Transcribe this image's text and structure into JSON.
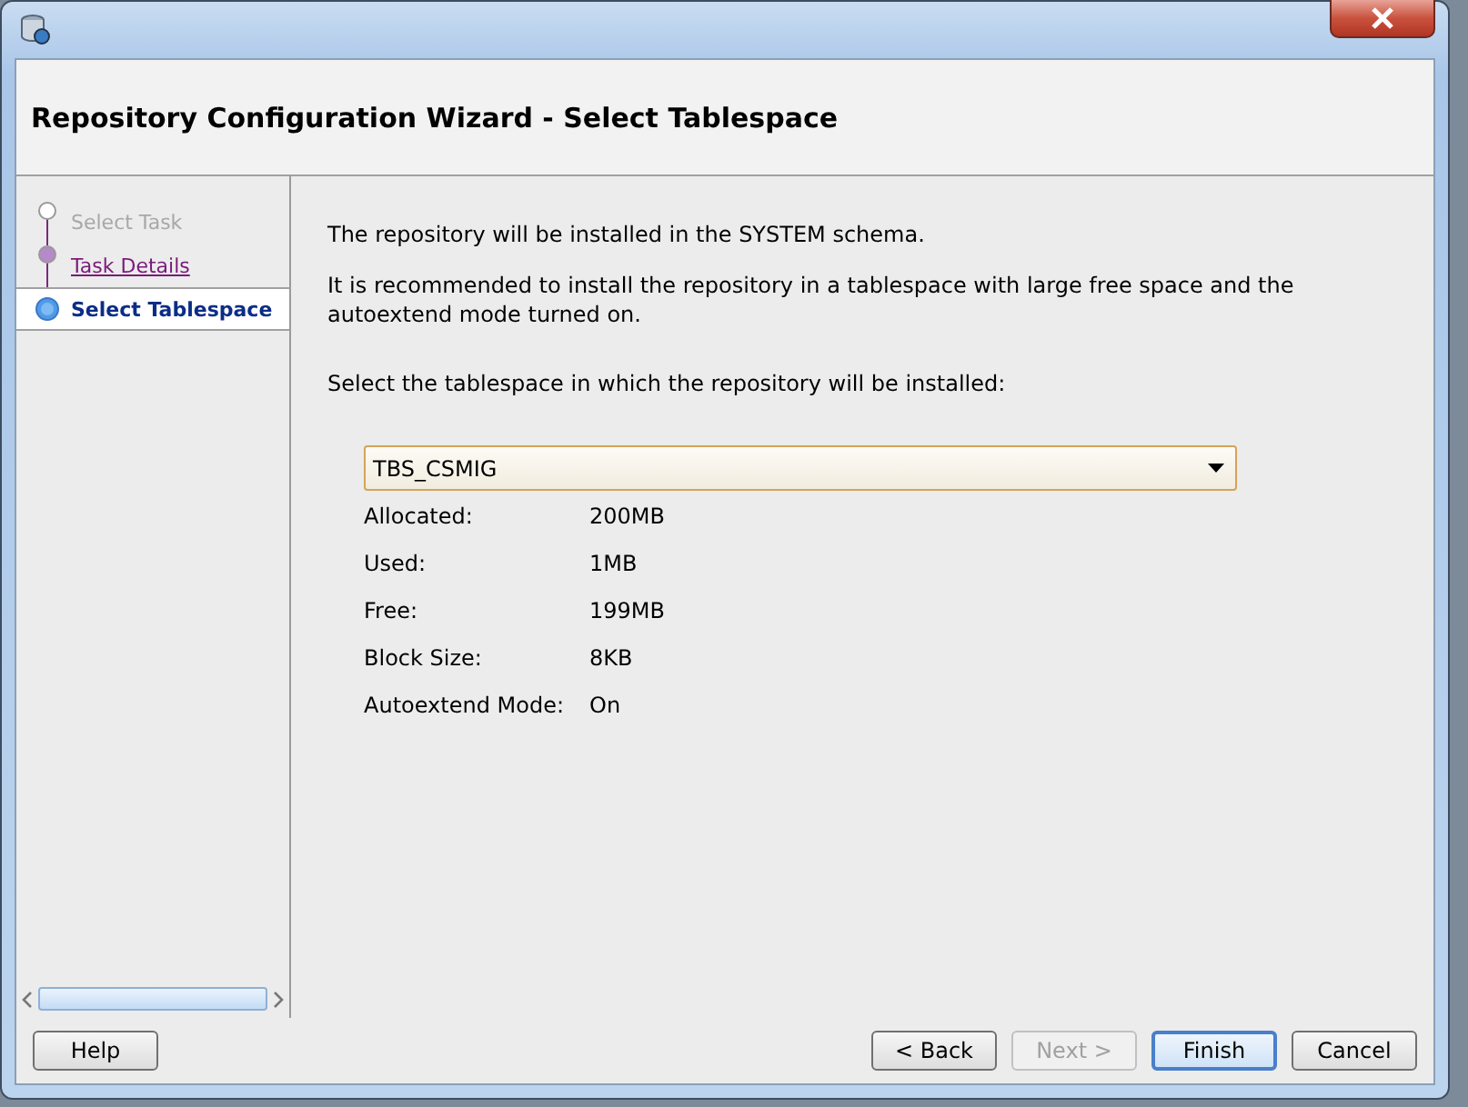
{
  "window": {
    "title": "Repository Configuration Wizard - Select Tablespace"
  },
  "steps": [
    {
      "label": "Select Task",
      "selected": false,
      "disabled": true,
      "visited": false
    },
    {
      "label": "Task Details",
      "selected": false,
      "disabled": false,
      "visited": true
    },
    {
      "label": "Select Tablespace",
      "selected": true,
      "disabled": false,
      "visited": false
    }
  ],
  "content": {
    "paragraphs": [
      "The repository will be installed in the SYSTEM schema.",
      "It is recommended to install the repository in a tablespace with large free space and the autoextend mode turned on.",
      "Select the tablespace in which the repository will be installed:"
    ],
    "tablespace_dropdown": {
      "value": "TBS_CSMIG"
    },
    "properties": [
      {
        "label": "Allocated:",
        "value": "200MB"
      },
      {
        "label": "Used:",
        "value": "1MB"
      },
      {
        "label": "Free:",
        "value": "199MB"
      },
      {
        "label": "Block Size:",
        "value": "8KB"
      },
      {
        "label": "Autoextend Mode:",
        "value": "On"
      }
    ]
  },
  "buttons_left": [
    {
      "label": "Help",
      "disabled": false,
      "default": false
    }
  ],
  "buttons_right": [
    {
      "label": "< Back",
      "disabled": false,
      "default": false
    },
    {
      "label": "Next >",
      "disabled": true,
      "default": false
    },
    {
      "label": "Finish",
      "disabled": false,
      "default": true
    },
    {
      "label": "Cancel",
      "disabled": false,
      "default": false
    }
  ]
}
